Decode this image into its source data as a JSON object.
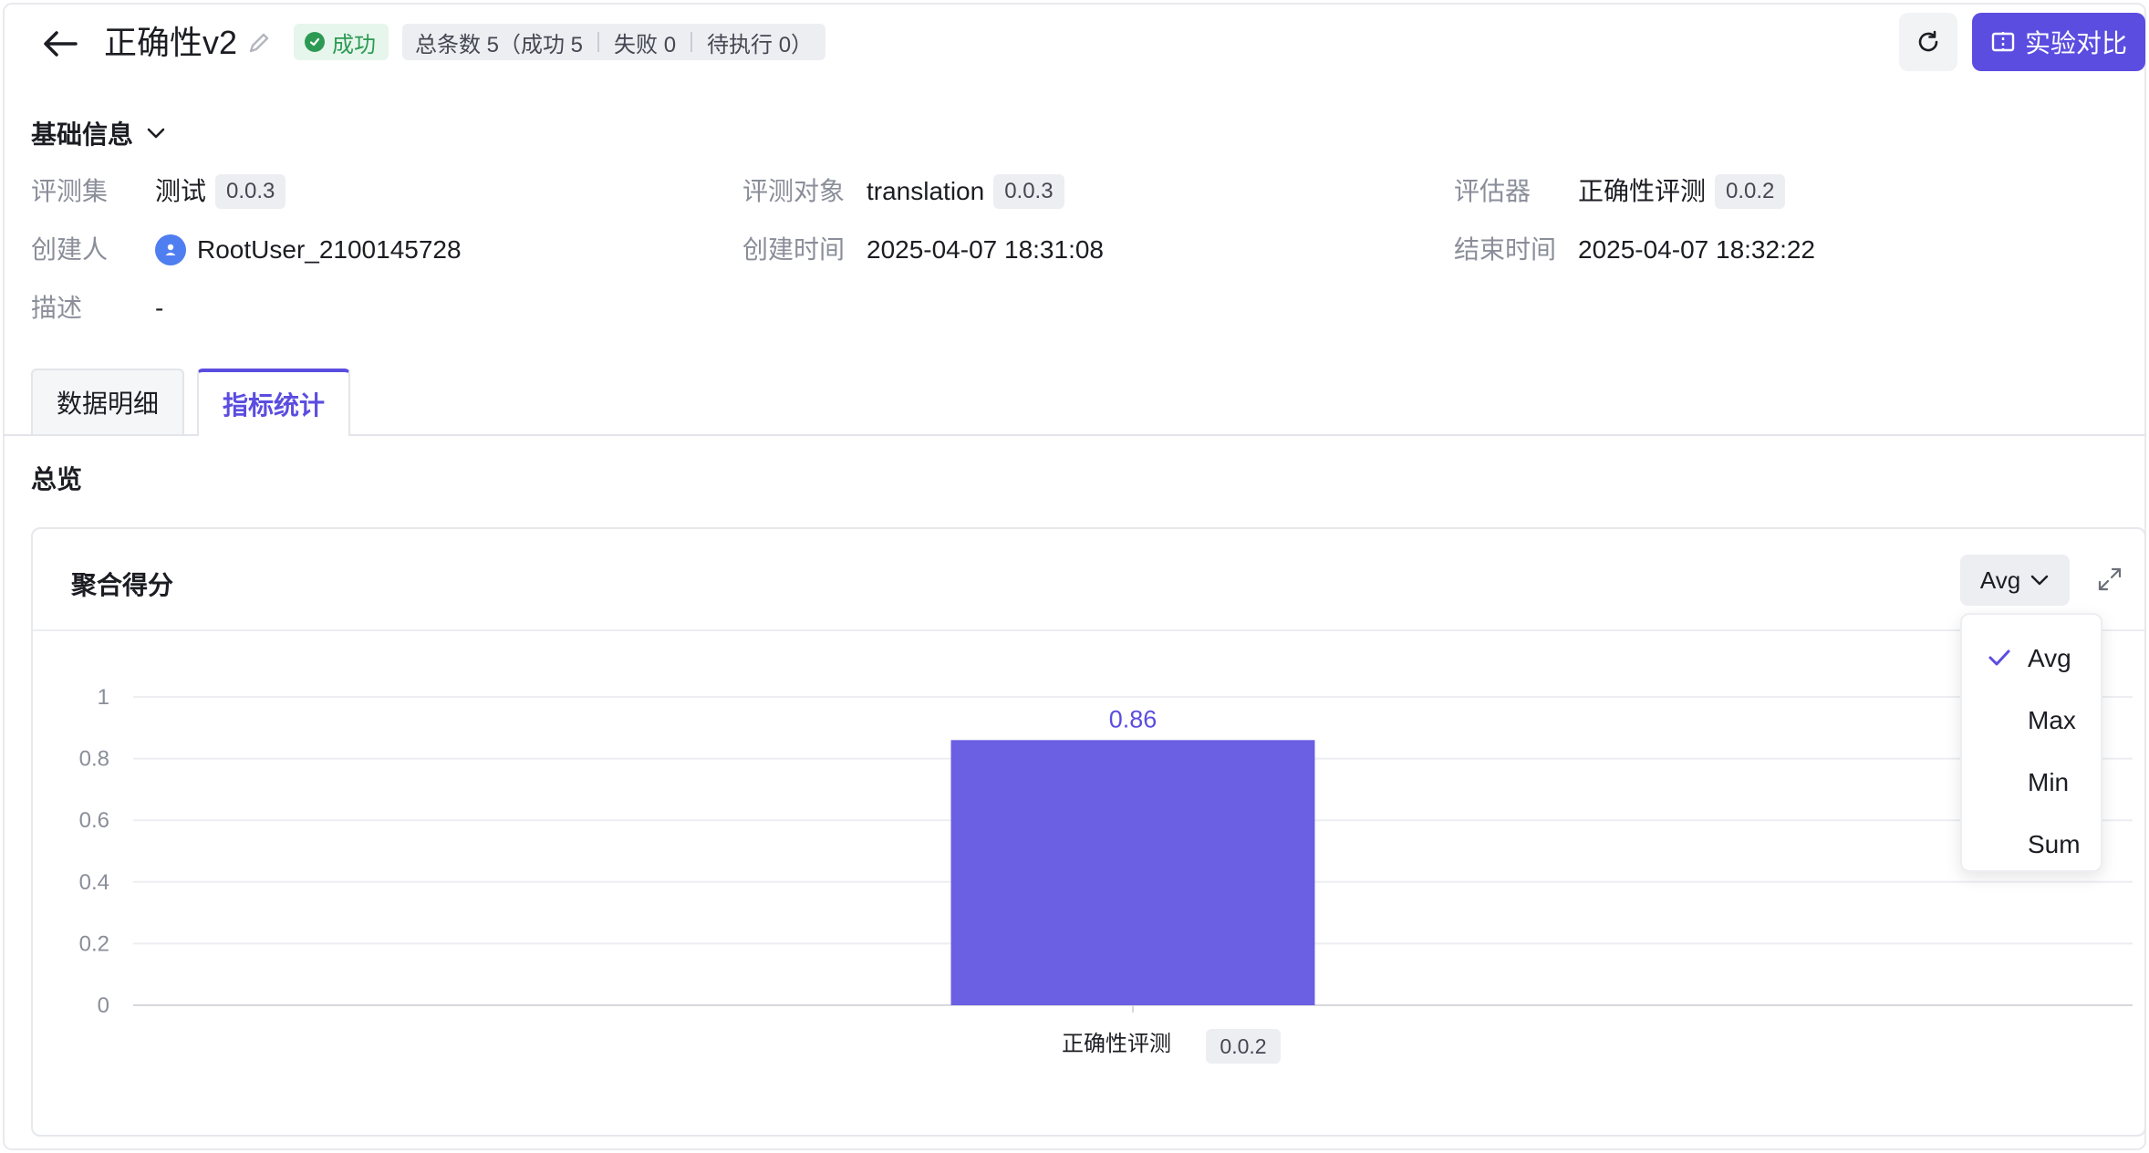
{
  "header": {
    "title": "正确性v2",
    "status": "成功",
    "counts": {
      "total": "总条数 5（成功 5",
      "failed": "失败 0",
      "pending": "待执行 0）"
    },
    "compare_label": "实验对比"
  },
  "basic_info": {
    "title": "基础信息",
    "eval_set_label": "评测集",
    "eval_set_value": "测试",
    "eval_set_version": "0.0.3",
    "eval_target_label": "评测对象",
    "eval_target_value": "translation",
    "eval_target_version": "0.0.3",
    "evaluator_label": "评估器",
    "evaluator_value": "正确性评测",
    "evaluator_version": "0.0.2",
    "creator_label": "创建人",
    "creator_value": "RootUser_2100145728",
    "created_time_label": "创建时间",
    "created_time_value": "2025-04-07 18:31:08",
    "end_time_label": "结束时间",
    "end_time_value": "2025-04-07 18:32:22",
    "description_label": "描述",
    "description_value": "-"
  },
  "tabs": [
    {
      "label": "数据明细",
      "active": false
    },
    {
      "label": "指标统计",
      "active": true
    }
  ],
  "overview": {
    "title": "总览",
    "card_title": "聚合得分",
    "aggregation_selected": "Avg",
    "aggregation_options": [
      "Avg",
      "Max",
      "Min",
      "Sum"
    ]
  },
  "chart_data": {
    "type": "bar",
    "categories": [
      "正确性评测"
    ],
    "category_version": "0.0.2",
    "values": [
      0.86
    ],
    "data_labels": [
      "0.86"
    ],
    "ylim": [
      0,
      1
    ],
    "yticks": [
      "0",
      "0.2",
      "0.4",
      "0.6",
      "0.8",
      "1"
    ],
    "grid": true,
    "bar_color": "#6b5fe3"
  },
  "colors": {
    "accent": "#5b4de0",
    "success": "#2d9a54"
  }
}
